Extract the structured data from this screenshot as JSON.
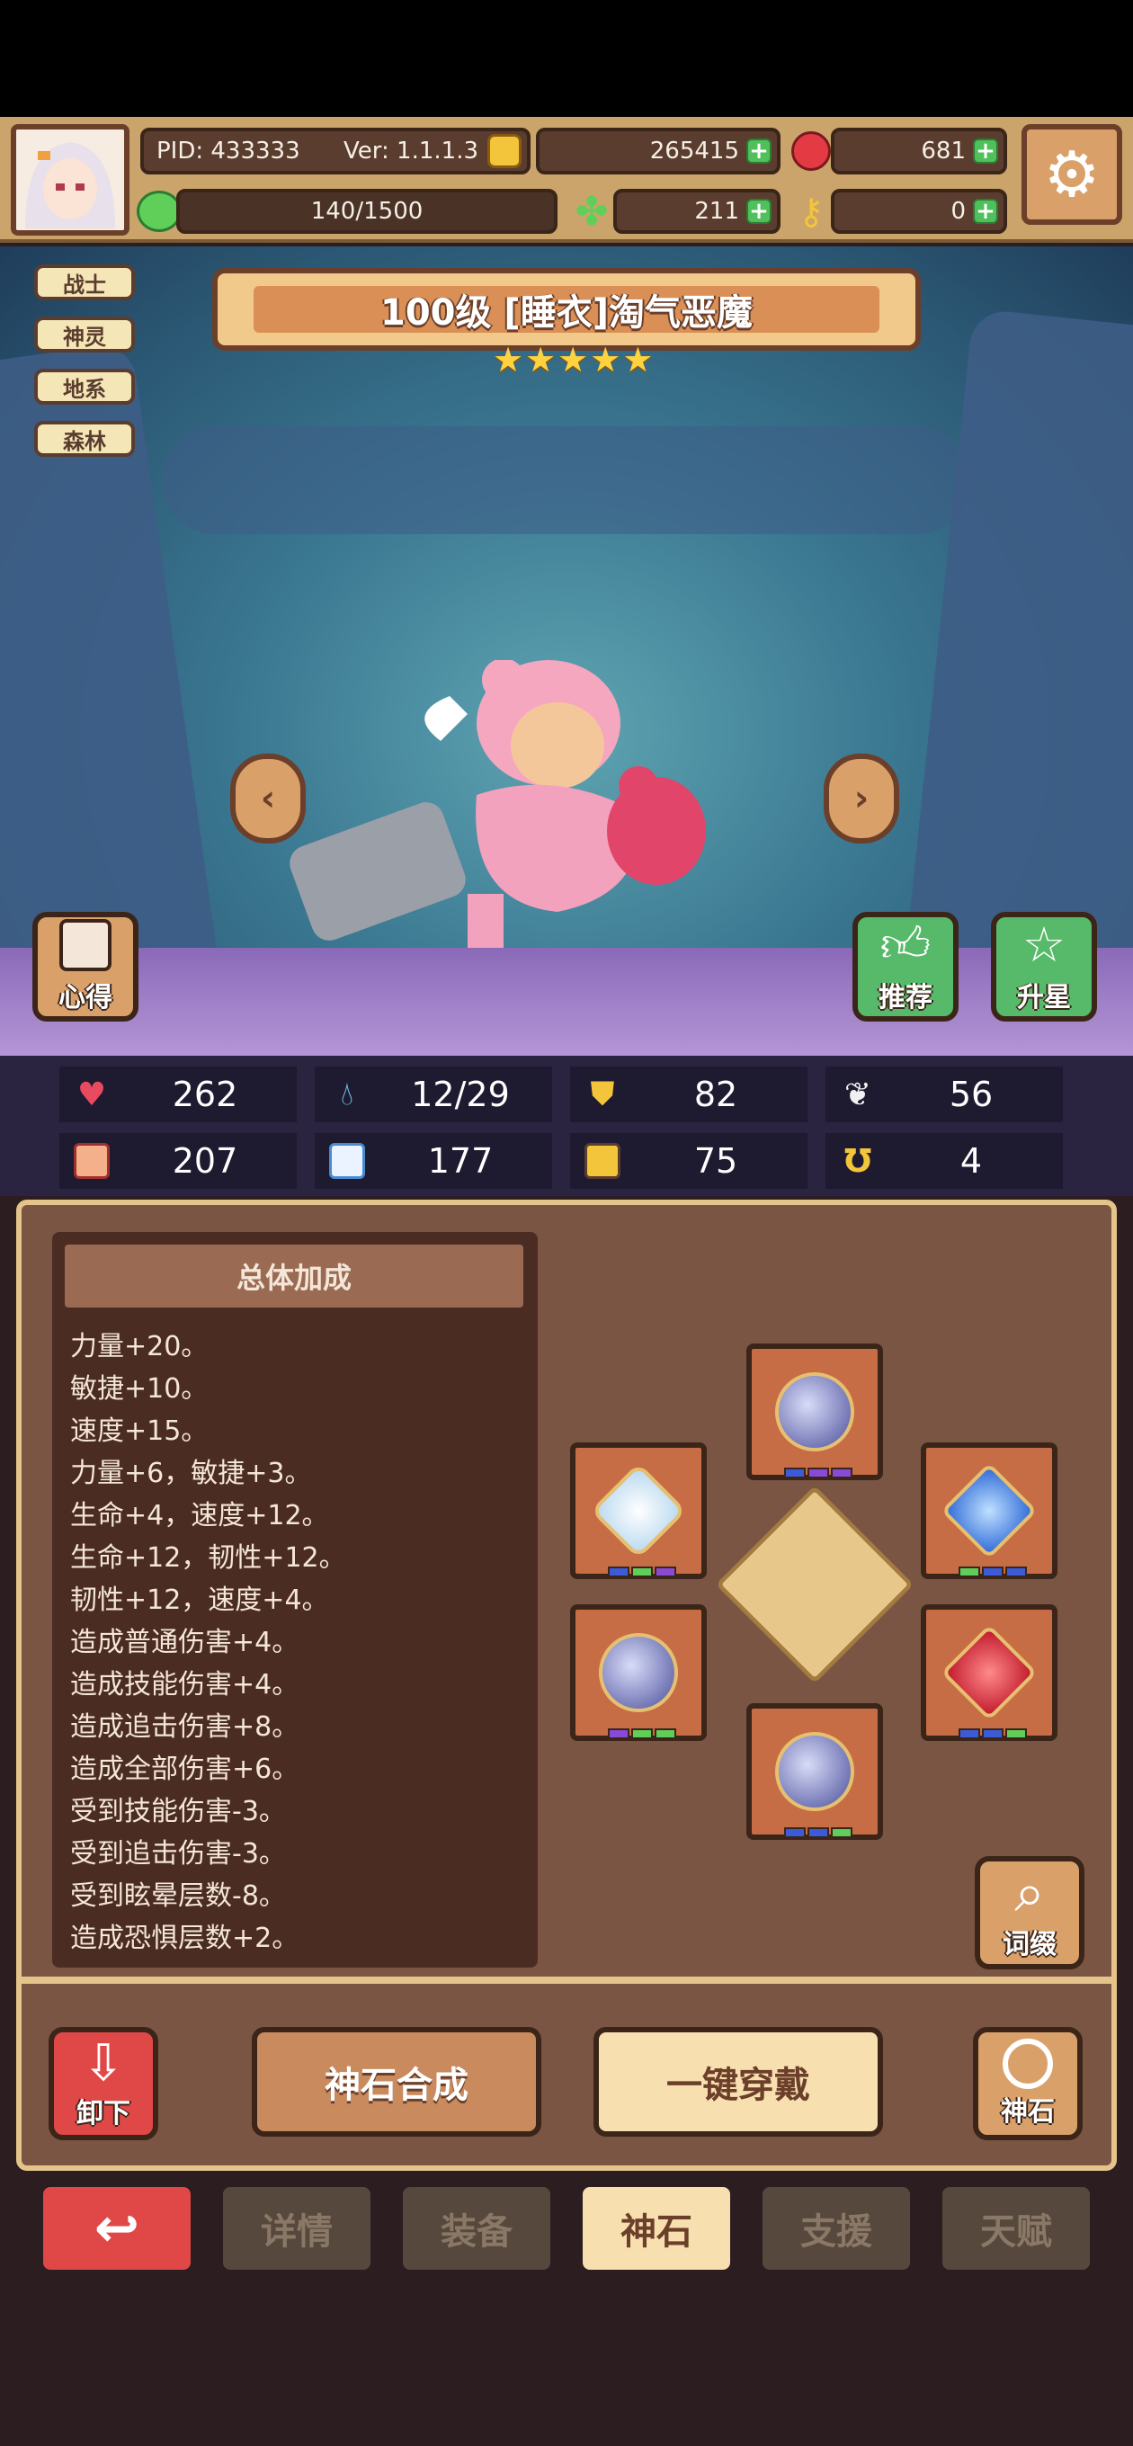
{
  "header": {
    "pid": "PID: 433333",
    "version": "Ver: 1.1.1.3",
    "gold": "265415",
    "gems": "681",
    "energy": "140/1500",
    "clover": "211",
    "key": "0"
  },
  "tags": [
    "战士",
    "神灵",
    "地系",
    "森林"
  ],
  "hero": {
    "title": "100级  [睡衣]淘气恶魔",
    "stars": 5
  },
  "scene_buttons": {
    "notes": "心得",
    "recommend": "推荐",
    "star_up": "升星"
  },
  "stats": [
    {
      "icon": "heart-icon",
      "value": "262"
    },
    {
      "icon": "drop-icon",
      "value": "12/29"
    },
    {
      "icon": "shield-icon",
      "value": "82"
    },
    {
      "icon": "wing-icon",
      "value": "56"
    },
    {
      "icon": "fist-icon",
      "value": "207"
    },
    {
      "icon": "book-icon",
      "value": "177"
    },
    {
      "icon": "boot-icon",
      "value": "75"
    },
    {
      "icon": "horseshoe-icon",
      "value": "4"
    }
  ],
  "bonus": {
    "title": "总体加成",
    "lines": [
      "力量+20。",
      "敏捷+10。",
      "速度+15。",
      "力量+6，敏捷+3。",
      "生命+4，速度+12。",
      "生命+12，韧性+12。",
      "韧性+12，速度+4。",
      "造成普通伤害+4。",
      "造成技能伤害+4。",
      "造成追击伤害+8。",
      "造成全部伤害+6。",
      "受到技能伤害-3。",
      "受到追击伤害-3。",
      "受到眩晕层数-8。",
      "造成恐惧层数+2。"
    ]
  },
  "panel_buttons": {
    "affix": "词缀",
    "unequip": "卸下",
    "synthesize": "神石合成",
    "equip_all": "一键穿戴",
    "godstone": "神石"
  },
  "tabs": [
    "详情",
    "装备",
    "神石",
    "支援",
    "天赋"
  ],
  "active_tab": "神石",
  "colors": {
    "plus_green": "#4fc05a",
    "tab_active": "#f7dfb0",
    "back_red": "#e04848"
  }
}
